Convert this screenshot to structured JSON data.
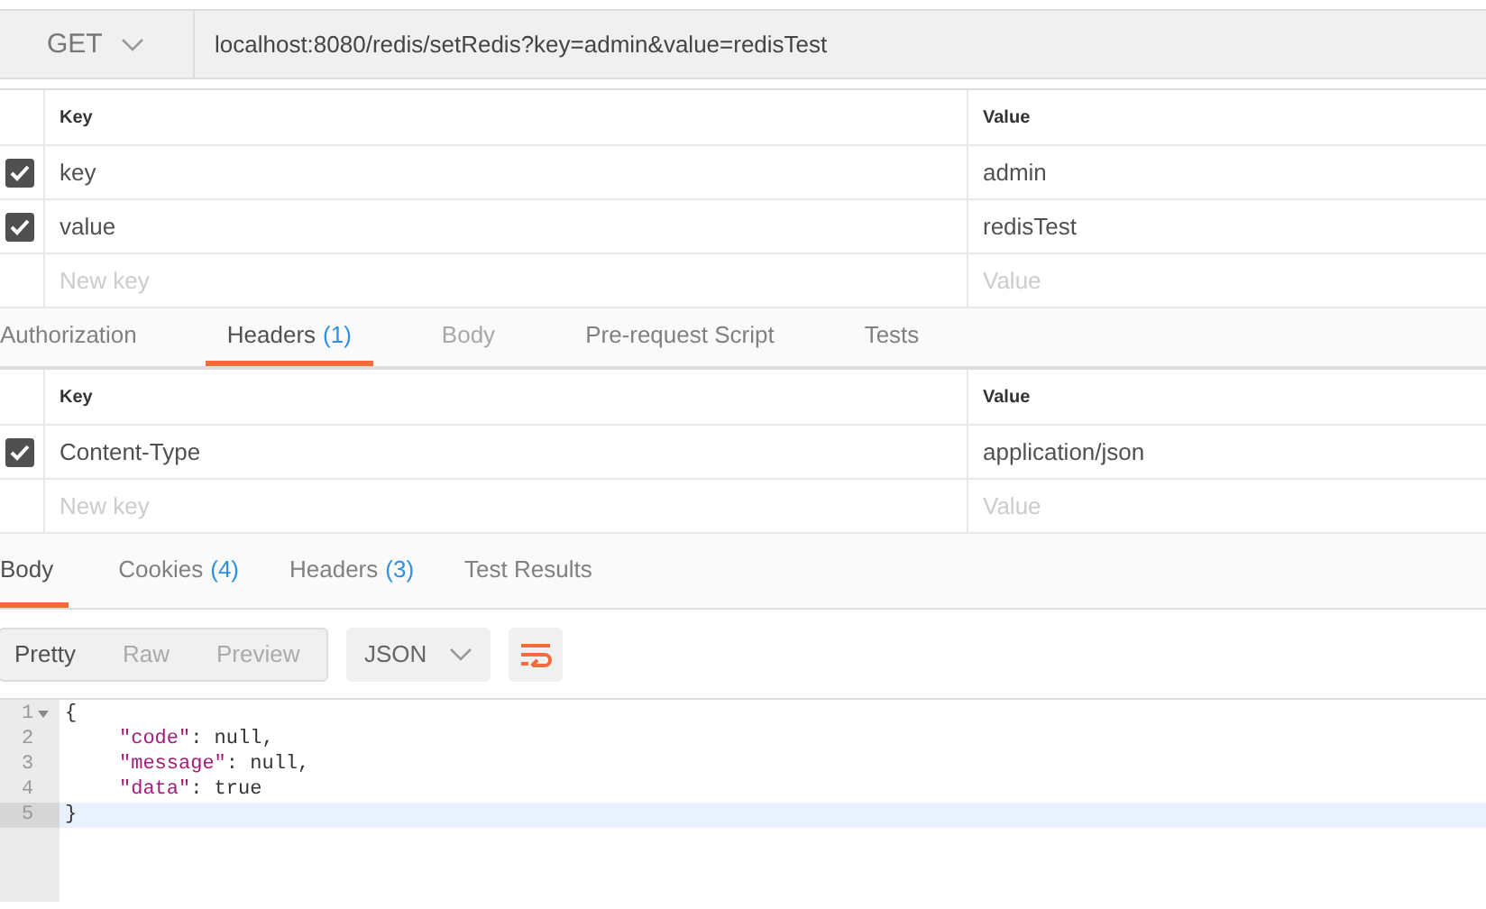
{
  "request": {
    "method": "GET",
    "url": "localhost:8080/redis/setRedis?key=admin&value=redisTest"
  },
  "params": {
    "columns": [
      "Key",
      "Value"
    ],
    "rows": [
      {
        "checked": true,
        "key": "key",
        "value": "admin"
      },
      {
        "checked": true,
        "key": "value",
        "value": "redisTest"
      }
    ],
    "new_row": {
      "key_placeholder": "New key",
      "value_placeholder": "Value"
    }
  },
  "request_tabs": [
    {
      "label": "Authorization",
      "selected": false,
      "disabled": false
    },
    {
      "label": "Headers",
      "count": "(1)",
      "selected": true,
      "disabled": false
    },
    {
      "label": "Body",
      "selected": false,
      "disabled": true
    },
    {
      "label": "Pre-request Script",
      "selected": false,
      "disabled": false
    },
    {
      "label": "Tests",
      "selected": false,
      "disabled": false
    }
  ],
  "headers": {
    "columns": [
      "Key",
      "Value"
    ],
    "rows": [
      {
        "checked": true,
        "key": "Content-Type",
        "value": "application/json"
      }
    ],
    "new_row": {
      "key_placeholder": "New key",
      "value_placeholder": "Value"
    }
  },
  "response_tabs": [
    {
      "label": "Body",
      "selected": true
    },
    {
      "label": "Cookies",
      "count": "(4)",
      "selected": false
    },
    {
      "label": "Headers",
      "count": "(3)",
      "selected": false
    },
    {
      "label": "Test Results",
      "selected": false
    }
  ],
  "view_modes": [
    {
      "label": "Pretty",
      "selected": true
    },
    {
      "label": "Raw",
      "selected": false
    },
    {
      "label": "Preview",
      "selected": false
    }
  ],
  "format": "JSON",
  "code_lines": [
    {
      "number": "1",
      "fold": true,
      "indent": false,
      "selected": false,
      "tokens": [
        {
          "kind": "punct",
          "text": "{"
        }
      ]
    },
    {
      "number": "2",
      "fold": false,
      "indent": true,
      "selected": false,
      "tokens": [
        {
          "kind": "key",
          "text": "\"code\""
        },
        {
          "kind": "punct",
          "text": ": null,"
        }
      ]
    },
    {
      "number": "3",
      "fold": false,
      "indent": true,
      "selected": false,
      "tokens": [
        {
          "kind": "key",
          "text": "\"message\""
        },
        {
          "kind": "punct",
          "text": ": null,"
        }
      ]
    },
    {
      "number": "4",
      "fold": false,
      "indent": true,
      "selected": false,
      "tokens": [
        {
          "kind": "key",
          "text": "\"data\""
        },
        {
          "kind": "punct",
          "text": ": true"
        }
      ]
    },
    {
      "number": "5",
      "fold": false,
      "indent": false,
      "selected": true,
      "tokens": [
        {
          "kind": "punct",
          "text": "}"
        }
      ]
    }
  ]
}
